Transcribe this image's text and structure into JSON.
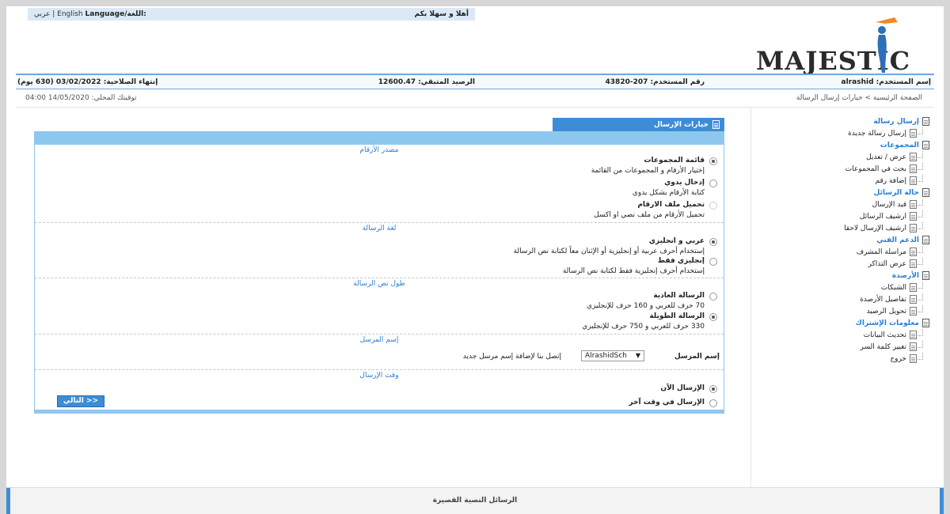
{
  "header": {
    "language_label": "Language/اللغة:",
    "lang_english": "English",
    "lang_sep": "|",
    "lang_arabic": "عربي",
    "welcome": "أهلا و سهلا بكم",
    "logo_text": "MAJESTIC"
  },
  "infobar": {
    "username": "إسم المستخدم: alrashid",
    "user_number": "رقم المستخدم: 207-43820",
    "balance": "الرصيد المتبقي: 12600.47",
    "expiry": "إنتهاء الصلاحية: 03/02/2022 (630 يوم)"
  },
  "breadcrumb": "الصفحة الرئيسية > خيارات إرسال الرسالة",
  "local_time": "توقيتك المحلي: 14/05/2020 04:00",
  "sidebar": [
    {
      "title": "إرسال رسالة",
      "items": [
        "إرسال رسالة جديدة"
      ]
    },
    {
      "title": "المجموعات",
      "items": [
        "عرض / تعديل",
        "بحث في المجموعات",
        "إضافة رقم"
      ]
    },
    {
      "title": "حالة الرسائل",
      "items": [
        "قيد الإرسال",
        "ارشيف الرسائل",
        "ارشيف الإرسال لاحقا"
      ]
    },
    {
      "title": "الدعم الفني",
      "items": [
        "مراسلة المشرف",
        "عرض التذاكر"
      ]
    },
    {
      "title": "الأرصدة",
      "items": [
        "الشبكات",
        "تفاصيل الأرصدة",
        "تحويل الرصيد"
      ]
    },
    {
      "title": "معلومات الإشتراك",
      "items": [
        "تحديث البيانات",
        "تغيير كلمة السر",
        "خروج"
      ]
    }
  ],
  "panel": {
    "tab_title": "خيارات الإرسال",
    "sections": {
      "source": {
        "title": "مصدر الأرقام",
        "options": [
          {
            "title": "قائمة المجموعات",
            "desc": "إختيار الأرقام و المجموعات من القائمة",
            "selected": true
          },
          {
            "title": "إدخال يدوي",
            "desc": "كتابة الأرقام بشكل يدوي",
            "selected": false
          },
          {
            "title": "تحميل ملف الارقام",
            "desc": "تحميل الأرقام من ملف نصي او اكسل",
            "selected": false
          }
        ]
      },
      "language": {
        "title": "لغة الرسالة",
        "options": [
          {
            "title": "عربي و انجليزي",
            "desc": "إستخدام أحرف عربية أو إنجليزية أو الإثنان معاً لكتابة نص الرسالة",
            "selected": true
          },
          {
            "title": "إنجليزي فقط",
            "desc": "إستخدام أحرف إنجليزية فقط لكتابة نص الرسالة",
            "selected": false
          }
        ]
      },
      "length": {
        "title": "طول نص الرسالة",
        "options": [
          {
            "title": "الرسالة العادية",
            "desc": "70 حرف للعربي و 160 حرف للإنجليزي",
            "selected": false
          },
          {
            "title": "الرسالة الطويلة",
            "desc": "330 حرف للعربي و 750 حرف للإنجليزي",
            "selected": true
          }
        ]
      },
      "sender": {
        "title": "إسم المرسل",
        "label": "إسم المرسل",
        "selected_value": "AlrashidSch",
        "hint": "إتصل بنا لإضافة إسم مرسل جديد"
      },
      "time": {
        "title": "وقت الإرسال",
        "options": [
          {
            "title": "الإرسال الآن",
            "selected": true
          },
          {
            "title": "الإرسال في وقت آخر",
            "selected": false
          }
        ]
      }
    },
    "next_button": "التالي >>"
  },
  "footer": "الرسائل النصية القصيرة"
}
